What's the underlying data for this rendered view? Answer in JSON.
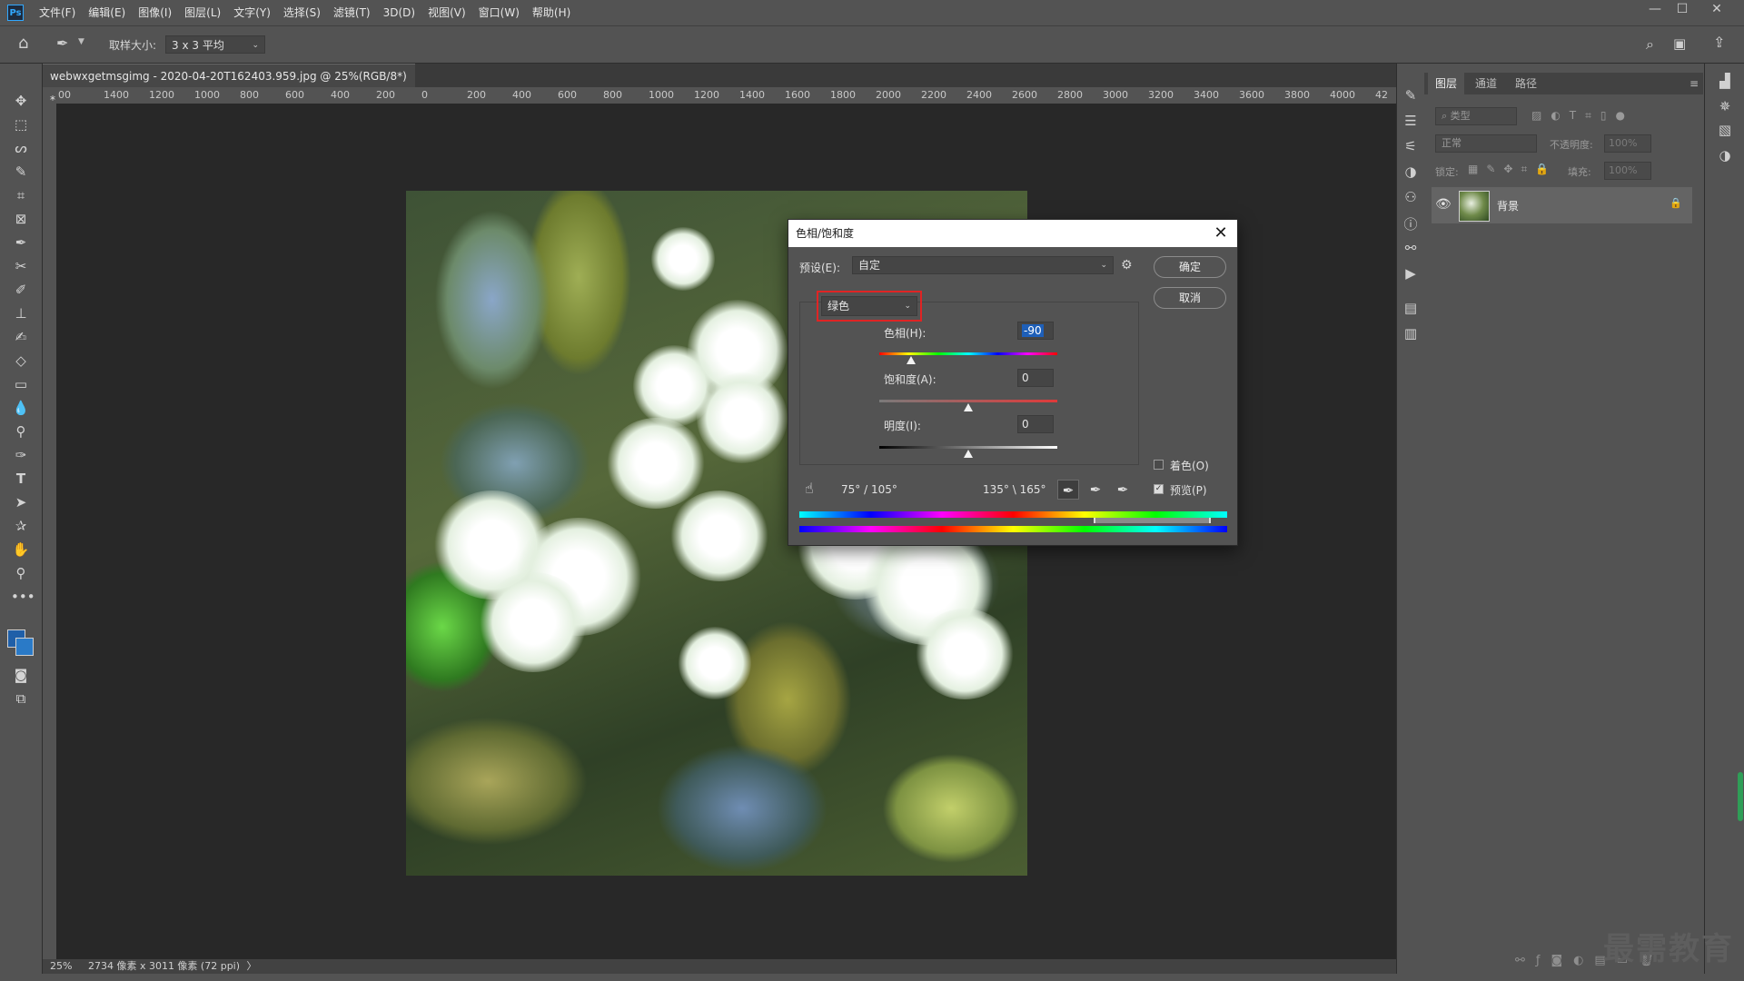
{
  "menubar": {
    "logo": "Ps",
    "items": [
      "文件(F)",
      "编辑(E)",
      "图像(I)",
      "图层(L)",
      "文字(Y)",
      "选择(S)",
      "滤镜(T)",
      "3D(D)",
      "视图(V)",
      "窗口(W)",
      "帮助(H)"
    ]
  },
  "options": {
    "sample_size_label": "取样大小:",
    "sample_size_value": "3 x 3 平均"
  },
  "document": {
    "tab_title": "webwxgetmsgimg - 2020-04-20T162403.959.jpg @ 25%(RGB/8*) *",
    "tab_close": "×",
    "ruler_ticks": [
      "00",
      "1400",
      "1200",
      "1000",
      "800",
      "600",
      "400",
      "200",
      "0",
      "200",
      "400",
      "600",
      "800",
      "1000",
      "1200",
      "1400",
      "1600",
      "1800",
      "2000",
      "2200",
      "2400",
      "2600",
      "2800",
      "3000",
      "3200",
      "3400",
      "3600",
      "3800",
      "4000",
      "42"
    ],
    "zoom": "25%",
    "status_info": "2734 像素 x 3011 像素 (72 ppi)"
  },
  "dialog": {
    "title": "色相/饱和度",
    "close": "✕",
    "preset_label": "预设(E):",
    "preset_value": "自定",
    "channel_value": "绿色",
    "hue_label": "色相(H):",
    "hue_value": "-90",
    "saturation_label": "饱和度(A):",
    "saturation_value": "0",
    "lightness_label": "明度(I):",
    "lightness_value": "0",
    "ok_label": "确定",
    "cancel_label": "取消",
    "colorize_label": "着色(O)",
    "colorize_checked": false,
    "preview_label": "预览(P)",
    "preview_checked": true,
    "range_left": "75° / 105°",
    "range_right": "135° \\ 165°"
  },
  "layers_panel": {
    "tabs": [
      "图层",
      "通道",
      "路径"
    ],
    "filter_placeholder": "类型",
    "blend_mode": "正常",
    "opacity_label": "不透明度:",
    "opacity_value": "100%",
    "lock_label": "锁定:",
    "fill_label": "填充:",
    "fill_value": "100%",
    "layer_name": "背景"
  },
  "watermark": "最需教育"
}
